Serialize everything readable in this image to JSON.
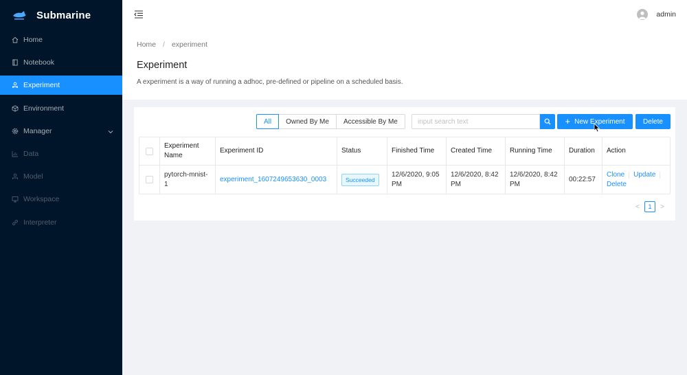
{
  "brand": {
    "name": "Submarine"
  },
  "sidebar": {
    "items": [
      {
        "label": "Home",
        "icon": "home-icon",
        "state": "normal"
      },
      {
        "label": "Notebook",
        "icon": "book-icon",
        "state": "normal"
      },
      {
        "label": "Experiment",
        "icon": "experiment-icon",
        "state": "active"
      },
      {
        "label": "Environment",
        "icon": "codesandbox-icon",
        "state": "normal"
      },
      {
        "label": "Manager",
        "icon": "gear-icon",
        "state": "normal"
      },
      {
        "label": "Data",
        "icon": "chart-icon",
        "state": "disabled"
      },
      {
        "label": "Model",
        "icon": "model-icon",
        "state": "disabled"
      },
      {
        "label": "Workspace",
        "icon": "desktop-icon",
        "state": "disabled"
      },
      {
        "label": "Interpreter",
        "icon": "link-icon",
        "state": "disabled"
      }
    ]
  },
  "header": {
    "user": "admin"
  },
  "breadcrumb": {
    "home": "Home",
    "sep": "/",
    "current": "experiment"
  },
  "page": {
    "title": "Experiment",
    "description": "A experiment is a way of running a adhoc, pre-defined or pipeline on a scheduled basis."
  },
  "filters": {
    "all": "All",
    "owned": "Owned By Me",
    "accessible": "Accessible By Me"
  },
  "search": {
    "placeholder": "input search text"
  },
  "buttons": {
    "new_prefix": "+",
    "new": "New Experiment",
    "delete": "Delete"
  },
  "table": {
    "headers": {
      "name": "Experiment Name",
      "id": "Experiment ID",
      "status": "Status",
      "finished": "Finished Time",
      "created": "Created Time",
      "running": "Running Time",
      "duration": "Duration",
      "action": "Action"
    },
    "rows": [
      {
        "name": "pytorch-mnist-1",
        "id": "experiment_1607249653630_0003",
        "status": "Succeeded",
        "finished": "12/6/2020, 9:05 PM",
        "created": "12/6/2020, 8:42 PM",
        "running": "12/6/2020, 8:42 PM",
        "duration": "00:22:57",
        "actions": {
          "clone": "Clone",
          "update": "Update",
          "delete": "Delete"
        }
      }
    ]
  },
  "pagination": {
    "prev": "<",
    "current": "1",
    "next": ">"
  },
  "colors": {
    "sidebar_bg": "#001529",
    "primary": "#1890ff",
    "page_bg": "#f0f2f5"
  }
}
